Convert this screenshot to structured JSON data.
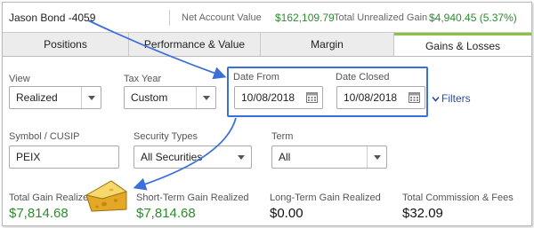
{
  "header": {
    "account_name": "Jason Bond -4059",
    "net_account_value_label": "Net Account Value",
    "net_account_value": "$162,109.79",
    "total_unrealized_gain_label": "Total Unrealized Gain",
    "total_unrealized_gain": "$4,940.45 (5.37%)"
  },
  "tabs": [
    {
      "label": "Positions",
      "active": false
    },
    {
      "label": "Performance & Value",
      "active": false
    },
    {
      "label": "Margin",
      "active": false
    },
    {
      "label": "Gains & Losses",
      "active": true
    }
  ],
  "filters": {
    "view": {
      "label": "View",
      "value": "Realized"
    },
    "tax_year": {
      "label": "Tax Year",
      "value": "Custom"
    },
    "date_from": {
      "label": "Date From",
      "value": "10/08/2018"
    },
    "date_closed": {
      "label": "Date Closed",
      "value": "10/08/2018"
    },
    "filters_link": "Filters",
    "symbol": {
      "label": "Symbol / CUSIP",
      "value": "PEIX"
    },
    "security_types": {
      "label": "Security Types",
      "value": "All Securities"
    },
    "term": {
      "label": "Term",
      "value": "All"
    }
  },
  "summary": {
    "total_gain": {
      "label": "Total Gain Realized",
      "value": "$7,814.68"
    },
    "short_term_gain": {
      "label": "Short-Term Gain Realized",
      "value": "$7,814.68"
    },
    "long_term_gain": {
      "label": "Long-Term Gain Realized",
      "value": "$0.00"
    },
    "commission_fees": {
      "label": "Total Commission & Fees",
      "value": "$32.09"
    }
  },
  "colors": {
    "gain_green": "#2e8b2e",
    "annotation_blue": "#3b6fd9",
    "active_tab_accent": "#8bc34a"
  }
}
